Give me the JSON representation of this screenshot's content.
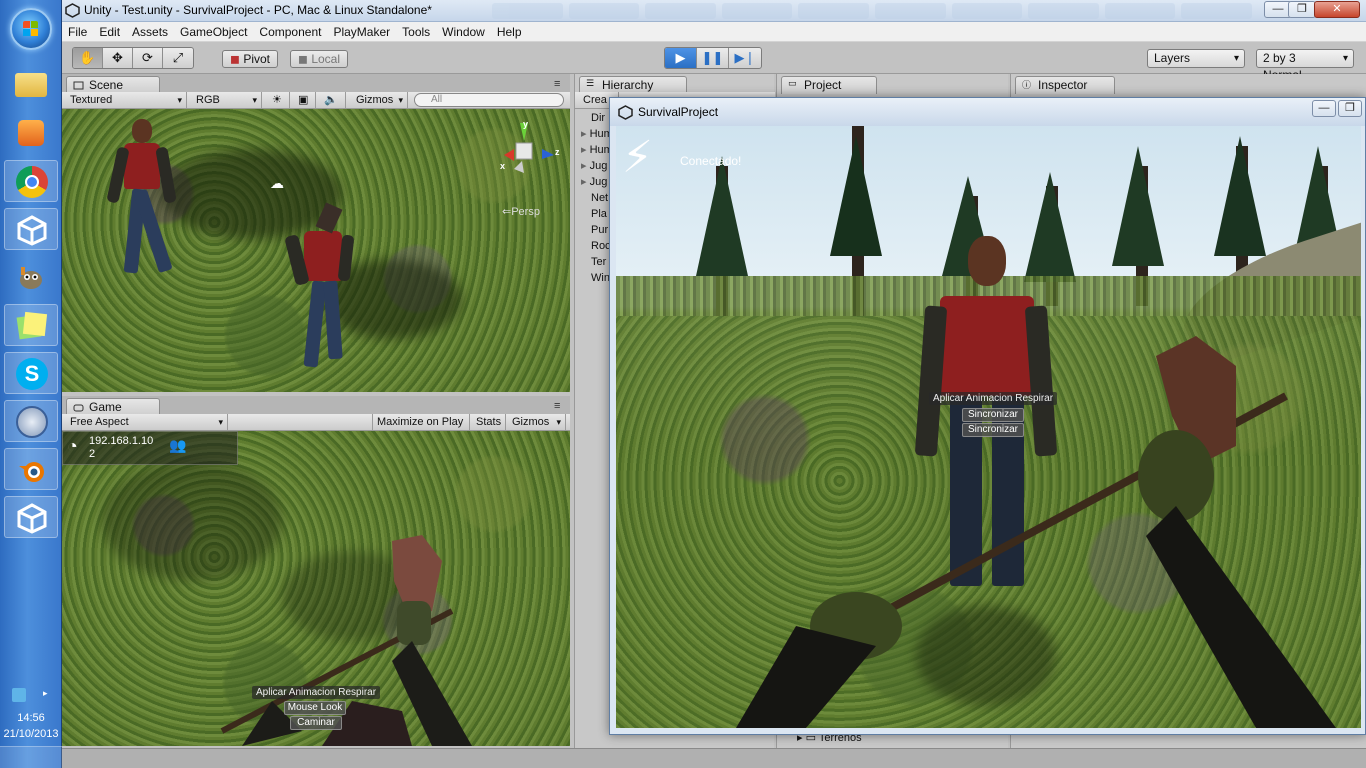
{
  "taskbar": {
    "start_label": "Start",
    "apps": [
      "file-explorer",
      "media-player",
      "chrome",
      "unity",
      "gimp",
      "sticky-notes",
      "skype",
      "remote-desktop",
      "blender",
      "unity"
    ],
    "tray": {
      "time": "14:56",
      "date": "21/10/2013"
    }
  },
  "window": {
    "title": "Unity - Test.unity - SurvivalProject - PC, Mac & Linux Standalone*",
    "buttons": {
      "minimize": "—",
      "maximize": "❐",
      "close": "✕"
    }
  },
  "menubar": [
    "File",
    "Edit",
    "Assets",
    "GameObject",
    "Component",
    "PlayMaker",
    "Tools",
    "Window",
    "Help"
  ],
  "toolbar": {
    "tools": [
      "hand-tool",
      "move-tool",
      "rotate-tool",
      "scale-tool"
    ],
    "pivot_label": "Pivot",
    "local_label": "Local",
    "play_state": "playing",
    "layers_label": "Layers",
    "layout_label": "2 by 3 Normal"
  },
  "scene_panel": {
    "tab": "Scene",
    "render_mode": "Textured",
    "color_mode": "RGB",
    "gizmos": "Gizmos",
    "search_placeholder": "All",
    "axes": {
      "y": "y",
      "x": "x",
      "z": "z"
    },
    "persp": "Persp"
  },
  "game_panel": {
    "tab": "Game",
    "aspect": "Free Aspect",
    "maximize": "Maximize on Play",
    "stats": "Stats",
    "gizmos": "Gizmos",
    "ip": "192.168.1.10",
    "players": "2",
    "hud": {
      "label": "Aplicar Animacion Respirar",
      "btn1": "Mouse Look",
      "btn2": "Caminar"
    }
  },
  "hierarchy_panel": {
    "tab": "Hierarchy",
    "create": "Crea",
    "items": [
      "Dir",
      "Hum",
      "Hum",
      "Jug",
      "Jug",
      "Net",
      "Pla",
      "Pur",
      "Roc",
      "Ter",
      "Win"
    ]
  },
  "project_panel": {
    "tab": "Project",
    "visible_item": "Terrenos"
  },
  "inspector_panel": {
    "tab": "Inspector"
  },
  "survival_window": {
    "title": "SurvivalProject",
    "status": "Conectado!",
    "hud": {
      "label": "Aplicar Animacion Respirar",
      "btn1": "Sincronizar",
      "btn2": "Sincronizar"
    }
  },
  "colors": {
    "play_accent": "#2b6fc4",
    "taskbar": "#3a78cc",
    "editor_bg": "#c2c2c2",
    "shirt_red": "#8e1f1f"
  }
}
